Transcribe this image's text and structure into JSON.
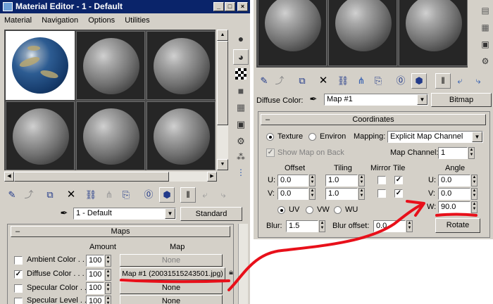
{
  "left": {
    "title": "Material Editor - 1 - Default",
    "title_buttons": [
      "_",
      "□",
      "×"
    ],
    "menu": [
      "Material",
      "Navigation",
      "Options",
      "Utilities"
    ],
    "material_name": "1 - Default",
    "material_type": "Standard",
    "maps_header": "Maps",
    "maps_collapse": "–",
    "col_amount": "Amount",
    "col_map": "Map",
    "rows": [
      {
        "label": "Ambient Color . . . .",
        "checked": false,
        "amount": "100",
        "map": "None"
      },
      {
        "label": "Diffuse Color . . . .",
        "checked": true,
        "amount": "100",
        "map": "Map #1 (20031515243501.jpg)"
      },
      {
        "label": "Specular Color . . .",
        "checked": false,
        "amount": "100",
        "map": "None"
      },
      {
        "label": "Specular Level . . .",
        "checked": false,
        "amount": "100",
        "map": "None"
      }
    ]
  },
  "right": {
    "diffuse_label": "Diffuse Color:",
    "map_name": "Map #1",
    "map_type": "Bitmap",
    "coords_header": "Coordinates",
    "coords_collapse": "–",
    "texture": "Texture",
    "environ": "Environ",
    "mapping_label": "Mapping:",
    "mapping_value": "Explicit Map Channel",
    "show_map": "Show Map on Back",
    "map_channel_label": "Map Channel:",
    "map_channel": "1",
    "offset": "Offset",
    "tiling": "Tiling",
    "mirror": "Mirror",
    "tile": "Tile",
    "angle": "Angle",
    "u_label": "U:",
    "v_label": "V:",
    "w_label": "W:",
    "u_offset": "0.0",
    "v_offset": "0.0",
    "u_tiling": "1.0",
    "v_tiling": "1.0",
    "u_angle": "0.0",
    "v_angle": "0.0",
    "w_angle": "90.0",
    "uv": "UV",
    "vw": "VW",
    "wu": "WU",
    "blur_label": "Blur:",
    "blur": "1.5",
    "blur_offset_label": "Blur offset:",
    "blur_offset": "0.0",
    "rotate": "Rotate"
  },
  "annotation_color": "#e8101a"
}
